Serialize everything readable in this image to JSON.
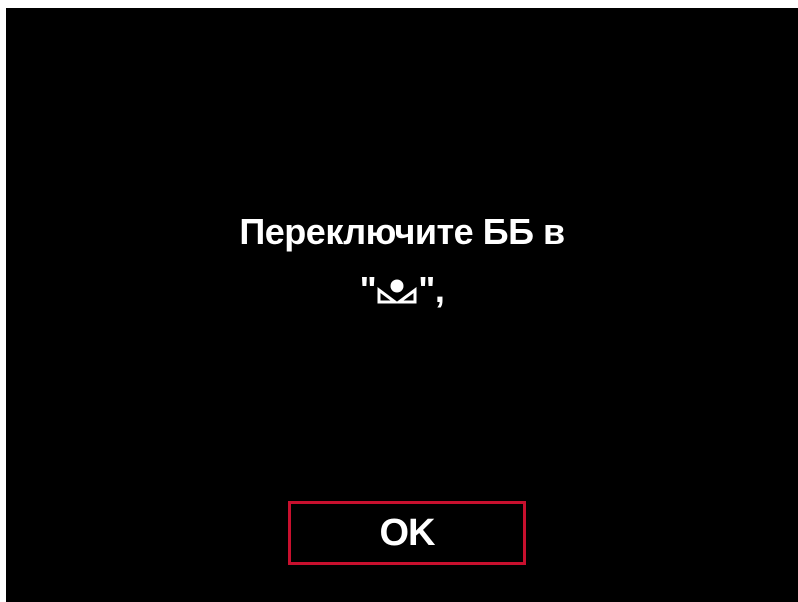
{
  "dialog": {
    "message_line1": "Переключите ББ в",
    "quote_open": "\"",
    "quote_close": "\",",
    "wb_icon": "custom-white-balance-icon",
    "ok_label": "OK"
  },
  "colors": {
    "background": "#000000",
    "text": "#ffffff",
    "selection_border": "#c8102e"
  }
}
